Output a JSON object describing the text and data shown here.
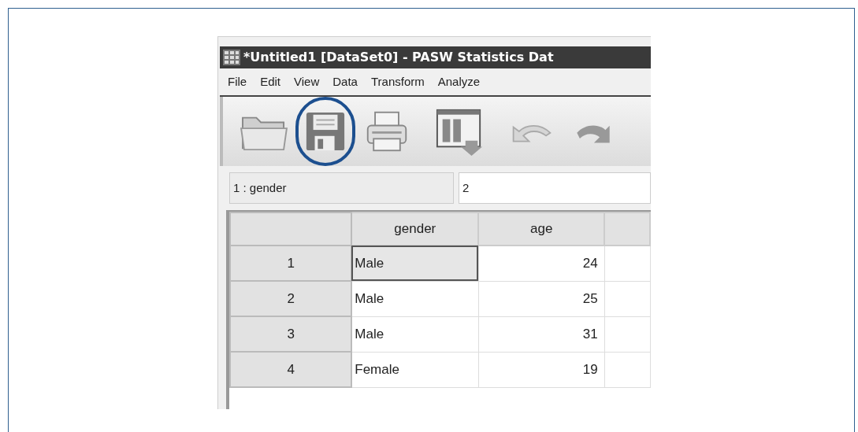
{
  "window": {
    "title": "*Untitled1 [DataSet0] - PASW Statistics Dat"
  },
  "menu": [
    "File",
    "Edit",
    "View",
    "Data",
    "Transform",
    "Analyze"
  ],
  "toolbar": [
    {
      "kind": "open",
      "highlighted": false
    },
    {
      "kind": "save",
      "highlighted": true
    },
    {
      "kind": "print",
      "highlighted": false
    },
    {
      "kind": "goto",
      "highlighted": false
    },
    {
      "kind": "undo",
      "highlighted": false
    },
    {
      "kind": "redo",
      "highlighted": false
    }
  ],
  "cell_ref": {
    "name": "1 : gender",
    "value": "2"
  },
  "table": {
    "columns": [
      "gender",
      "age"
    ],
    "rows": [
      {
        "number": "1",
        "cells": [
          {
            "text": "Male",
            "selected": true
          },
          {
            "text": "24",
            "selected": false
          }
        ]
      },
      {
        "number": "2",
        "cells": [
          {
            "text": "Male",
            "selected": false
          },
          {
            "text": "25",
            "selected": false
          }
        ]
      },
      {
        "number": "3",
        "cells": [
          {
            "text": "Male",
            "selected": false
          },
          {
            "text": "31",
            "selected": false
          }
        ]
      },
      {
        "number": "4",
        "cells": [
          {
            "text": "Female",
            "selected": false
          },
          {
            "text": "19",
            "selected": false
          }
        ]
      }
    ]
  }
}
